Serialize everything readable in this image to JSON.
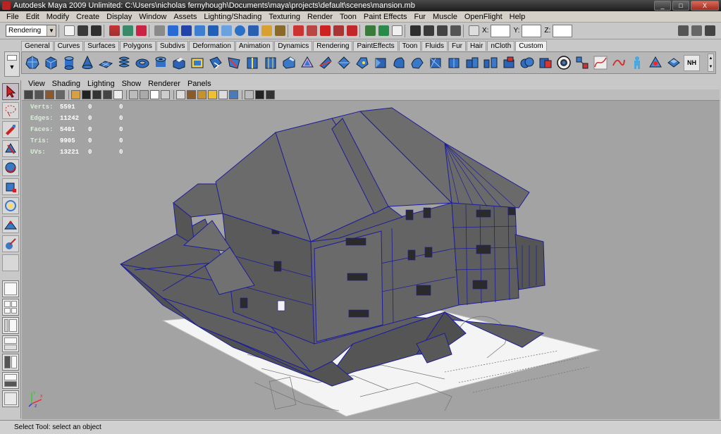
{
  "window": {
    "title": "Autodesk Maya 2009 Unlimited: C:\\Users\\nicholas fernyhough\\Documents\\maya\\projects\\default\\scenes\\mansion.mb",
    "minimize": "_",
    "maximize": "□",
    "close": "X"
  },
  "menubar": [
    "File",
    "Edit",
    "Modify",
    "Create",
    "Display",
    "Window",
    "Assets",
    "Lighting/Shading",
    "Texturing",
    "Render",
    "Toon",
    "Paint Effects",
    "Fur",
    "Muscle",
    "OpenFlight",
    "Help"
  ],
  "statusline": {
    "menuset": "Rendering",
    "x_label": "X:",
    "y_label": "Y:",
    "z_label": "Z:"
  },
  "shelf": {
    "tabs": [
      "General",
      "Curves",
      "Surfaces",
      "Polygons",
      "Subdivs",
      "Deformation",
      "Animation",
      "Dynamics",
      "Rendering",
      "PaintEffects",
      "Toon",
      "Fluids",
      "Fur",
      "Hair",
      "nCloth",
      "Custom"
    ],
    "active_tab": "Custom",
    "last_icon_label": "NH"
  },
  "panel": {
    "menus": [
      "View",
      "Shading",
      "Lighting",
      "Show",
      "Renderer",
      "Panels"
    ]
  },
  "hud": {
    "rows": [
      {
        "label": "Verts:",
        "v1": "5591",
        "v2": "0",
        "v3": "0"
      },
      {
        "label": "Edges:",
        "v1": "11242",
        "v2": "0",
        "v3": "0"
      },
      {
        "label": "Faces:",
        "v1": "5401",
        "v2": "0",
        "v3": "0"
      },
      {
        "label": "Tris:",
        "v1": "9905",
        "v2": "0",
        "v3": "0"
      },
      {
        "label": "UVs:",
        "v1": "13221",
        "v2": "0",
        "v3": "0"
      }
    ]
  },
  "axis": {
    "x": "x",
    "y": "y",
    "z": "z"
  },
  "helpline": "Select Tool: select an object",
  "colors": {
    "viewport_bg": "#a3a3a3",
    "mesh_fill": "#5c5c5c",
    "mesh_wire": "#1d1d9c",
    "active_tool": "#c7bcc7"
  }
}
